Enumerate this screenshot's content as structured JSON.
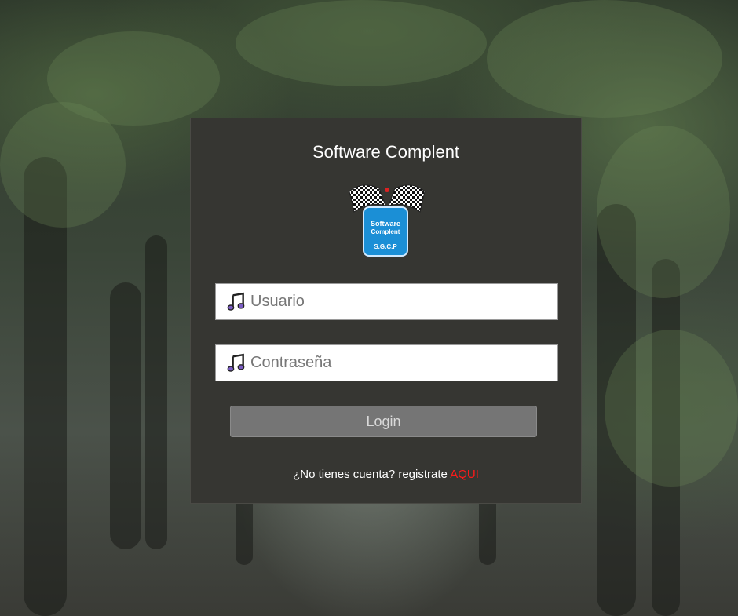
{
  "login": {
    "title": "Software Complent",
    "logo": {
      "brand_line1": "Software",
      "brand_line2": "Complent",
      "acronym": "S.G.C.P",
      "icon": "checkered-flags-icon"
    },
    "username": {
      "placeholder": "Usuario",
      "value": "",
      "icon": "music-note-icon"
    },
    "password": {
      "placeholder": "Contraseña",
      "value": "",
      "icon": "music-note-icon"
    },
    "submit_label": "Login",
    "signup_prompt": "¿No tienes cuenta? registrate",
    "signup_link": "AQUI"
  },
  "colors": {
    "panel_bg": "#363632",
    "button_bg": "#757575",
    "link": "#ff1a1a",
    "logo_blue": "#1b8fd6"
  }
}
